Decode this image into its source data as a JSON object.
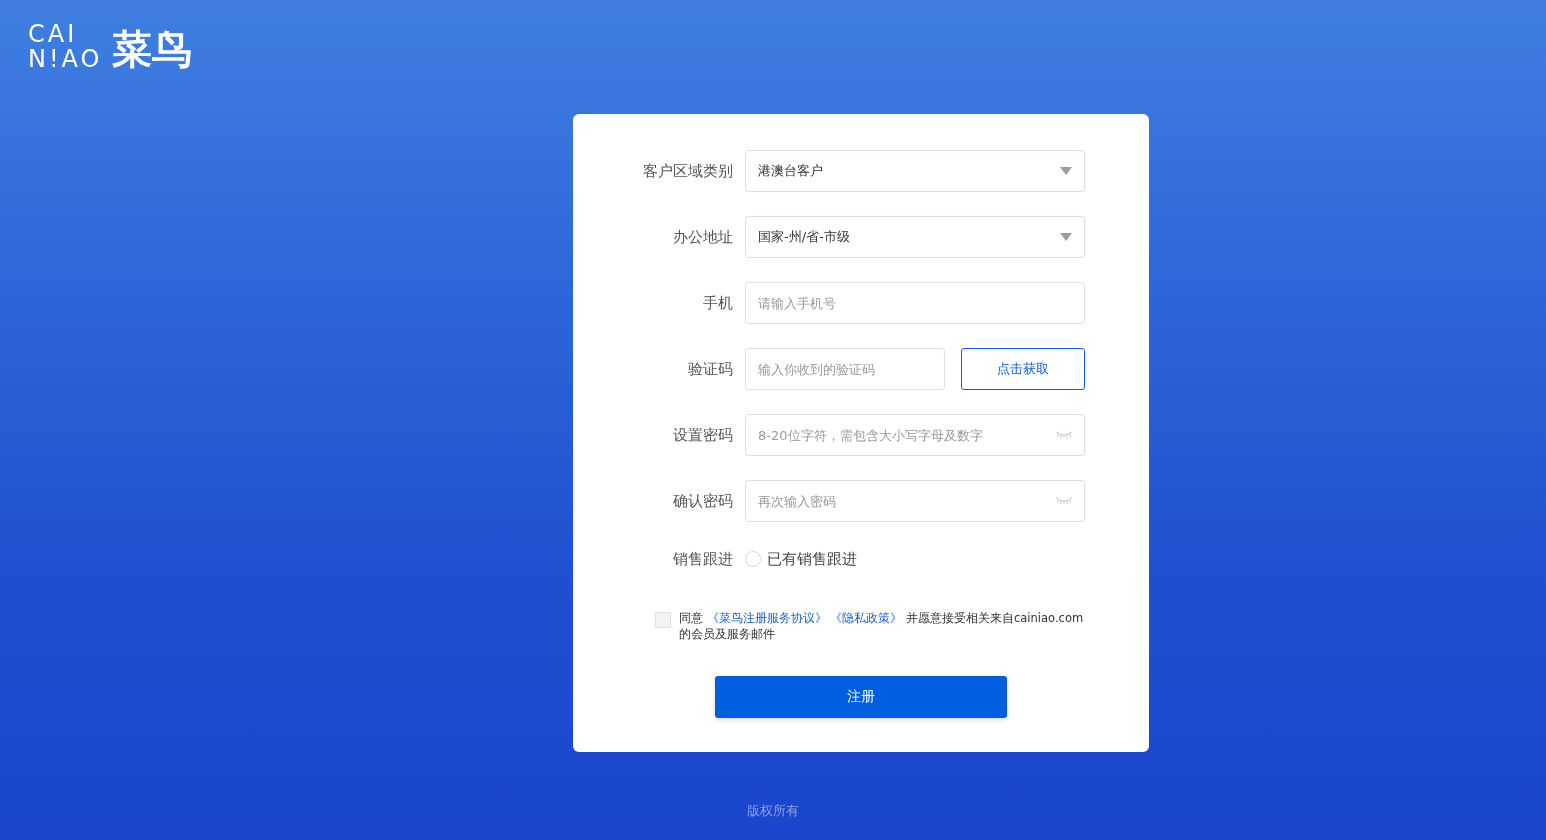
{
  "logo": {
    "latin_top": "CAI",
    "latin_bottom": "N!AO",
    "chinese": "菜鸟"
  },
  "form": {
    "fields": [
      {
        "kind": "select",
        "label": "客户区域类别",
        "value": "港澳台客户"
      },
      {
        "kind": "select",
        "label": "办公地址",
        "value": "国家-州/省-市级"
      },
      {
        "kind": "text",
        "label": "手机",
        "placeholder": "请输入手机号"
      },
      {
        "kind": "code",
        "label": "验证码",
        "placeholder": "输入你收到的验证码",
        "button": "点击获取"
      },
      {
        "kind": "password",
        "label": "设置密码",
        "placeholder": "8-20位字符，需包含大小写字母及数字"
      },
      {
        "kind": "password",
        "label": "确认密码",
        "placeholder": "再次输入密码"
      },
      {
        "kind": "radio",
        "label": "销售跟进",
        "option": "已有销售跟进",
        "selected": false
      }
    ],
    "agreement": {
      "checked": false,
      "prefix": "同意",
      "links": [
        "《菜鸟注册服务协议》",
        "《隐私政策》"
      ],
      "suffix": "并愿意接受相关来自cainiao.com的会员及服务邮件"
    },
    "submit": "注册"
  },
  "footer": "版权所有"
}
